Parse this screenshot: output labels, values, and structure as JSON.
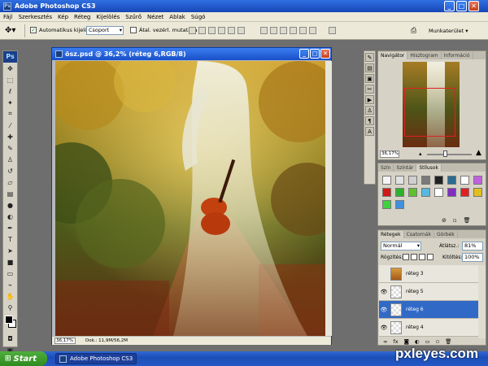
{
  "window": {
    "title": "Adobe Photoshop CS3",
    "app_icon": "Ps",
    "buttons": [
      "_",
      "□",
      "✕"
    ]
  },
  "menu": [
    "Fájl",
    "Szerkesztés",
    "Kép",
    "Réteg",
    "Kijelölés",
    "Szűrő",
    "Nézet",
    "Ablak",
    "Súgó"
  ],
  "options": {
    "auto_select_label": "Automatikus kijelölés:",
    "auto_select_checked": true,
    "group_value": "Csoport",
    "transform_label": "Átal. vezérl. mutatása",
    "workspace_label": "Munkaterület"
  },
  "toolbox": {
    "logo": "Ps",
    "tools": [
      "move-icon",
      "marquee-icon",
      "lasso-icon",
      "magic-wand-icon",
      "crop-icon",
      "slice-icon",
      "healing-icon",
      "brush-icon",
      "clone-stamp-icon",
      "history-brush-icon",
      "eraser-icon",
      "gradient-icon",
      "blur-icon",
      "dodge-icon",
      "pen-icon",
      "type-icon",
      "path-select-icon",
      "shape-icon",
      "notes-icon",
      "eyedropper-icon",
      "hand-icon",
      "zoom-icon"
    ]
  },
  "document": {
    "title": "ösz.psd @ 36,2% (réteg 6,RGB/8)",
    "zoom": "36,17%",
    "doc_info": "Dok.: 11,9M/56,2M"
  },
  "navigator": {
    "tabs": [
      "Navigátor",
      "Hisztogram",
      "Információ"
    ],
    "zoom": "36,17%"
  },
  "styles_panel": {
    "tabs": [
      "Szín",
      "Színtár",
      "Stílusok"
    ],
    "swatches": [
      "#f4f4f4",
      "#e2e2e2",
      "#cfcfcf",
      "#7a7a7a",
      "#222222",
      "#2b6b8f",
      "#ffffff",
      "#c060e0",
      "#d01818",
      "#30b030",
      "#60c030",
      "#58b8e0",
      "#ffffff",
      "#8030c0",
      "#e02020",
      "#e0c020",
      "#40d040",
      "#4090e0"
    ]
  },
  "layers_panel": {
    "tabs": [
      "Rétegek",
      "Csatornák",
      "Görbék"
    ],
    "blend_mode": "Normál",
    "opacity_label": "Átlátsz.:",
    "opacity_value": "81%",
    "lock_label": "Rögzítés:",
    "fill_label": "Kitöltés:",
    "fill_value": "100%",
    "layers": [
      {
        "name": "réteg 3",
        "visible": false,
        "selected": false
      },
      {
        "name": "réteg 5",
        "visible": true,
        "selected": false
      },
      {
        "name": "réteg 6",
        "visible": true,
        "selected": true
      },
      {
        "name": "réteg 4",
        "visible": true,
        "selected": false
      }
    ]
  },
  "taskbar": {
    "start_label": "Start",
    "task_label": "Adobe Photoshop CS3"
  },
  "watermark": "pxleyes.com"
}
